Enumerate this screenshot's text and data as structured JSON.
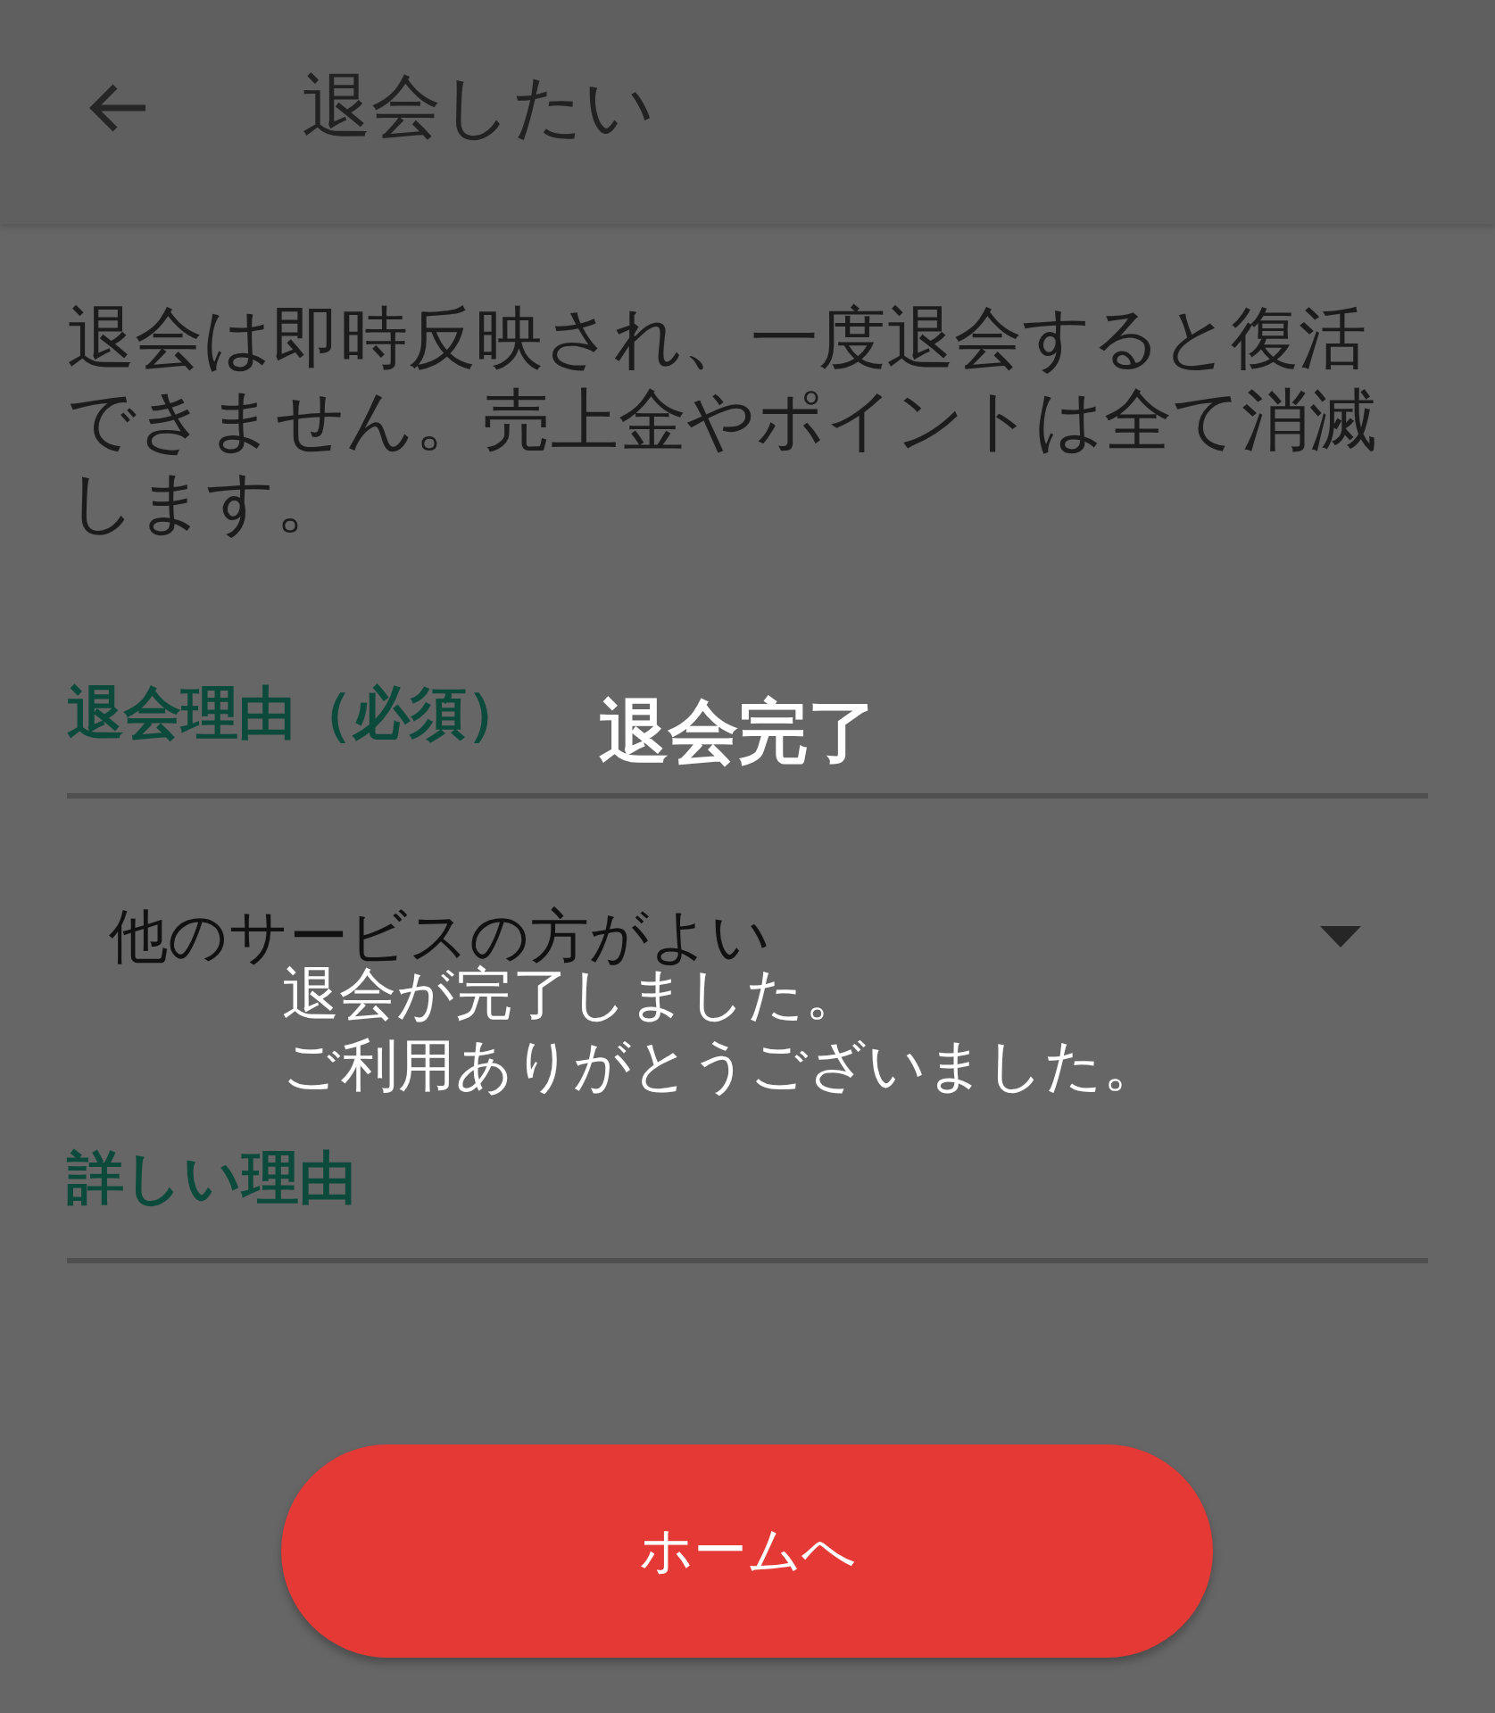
{
  "app_bar": {
    "title": "退会したい"
  },
  "notice": "退会は即時反映され、一度退会すると復活できません。売上金やポイントは全て消滅します。",
  "form": {
    "fields": [
      {
        "label": "退会理由（必須）",
        "kind": "dropdown",
        "value": "他のサービスの方がよい"
      },
      {
        "label": "詳しい理由",
        "kind": "text"
      }
    ]
  },
  "dialog": {
    "title": "退会完了",
    "message_lines": [
      "退会が完了しました。",
      "ご利用ありがとうございました。"
    ],
    "button": "ホームへ"
  }
}
